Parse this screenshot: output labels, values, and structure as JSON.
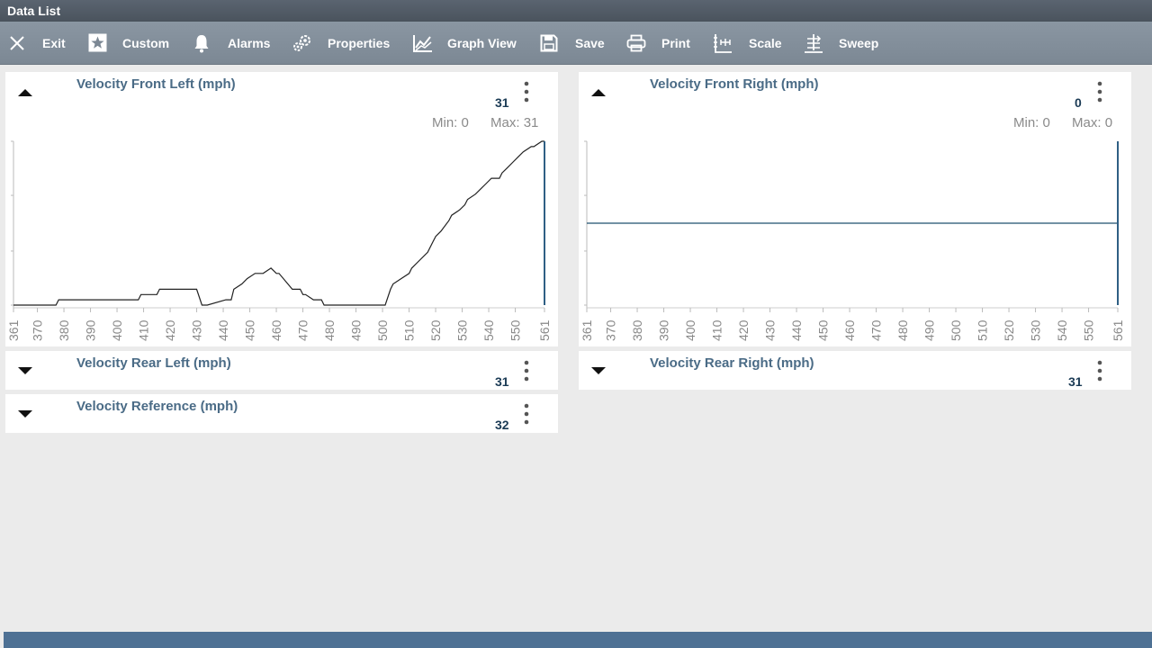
{
  "window": {
    "title": "Data List"
  },
  "toolbar": [
    {
      "id": "exit",
      "label": "Exit",
      "icon": "close-icon"
    },
    {
      "id": "custom",
      "label": "Custom",
      "icon": "star-icon"
    },
    {
      "id": "alarms",
      "label": "Alarms",
      "icon": "bell-icon"
    },
    {
      "id": "properties",
      "label": "Properties",
      "icon": "gears-icon"
    },
    {
      "id": "graph-view",
      "label": "Graph View",
      "icon": "graph-icon"
    },
    {
      "id": "save",
      "label": "Save",
      "icon": "floppy-icon"
    },
    {
      "id": "print",
      "label": "Print",
      "icon": "printer-icon"
    },
    {
      "id": "scale",
      "label": "Scale",
      "icon": "scale-icon"
    },
    {
      "id": "sweep",
      "label": "Sweep",
      "icon": "sweep-icon"
    }
  ],
  "panels": {
    "front_left": {
      "title": "Velocity Front Left (mph)",
      "value": "31",
      "min_label": "Min: 0",
      "max_label": "Max: 31"
    },
    "front_right": {
      "title": "Velocity Front Right (mph)",
      "value": "0",
      "min_label": "Min: 0",
      "max_label": "Max: 0"
    },
    "rear_left": {
      "title": "Velocity Rear Left (mph)",
      "value": "31"
    },
    "rear_right": {
      "title": "Velocity Rear Right (mph)",
      "value": "31"
    },
    "reference": {
      "title": "Velocity Reference (mph)",
      "value": "32"
    }
  },
  "chart_data": [
    {
      "type": "line",
      "series_of": "Velocity Front Left (mph)",
      "x_ticks": [
        "361",
        "370",
        "380",
        "390",
        "400",
        "410",
        "420",
        "430",
        "440",
        "450",
        "460",
        "470",
        "480",
        "490",
        "500",
        "510",
        "520",
        "530",
        "540",
        "550",
        "561"
      ],
      "xlim": [
        361,
        561
      ],
      "ylim": [
        0,
        31
      ],
      "x": [
        361,
        377,
        378,
        408,
        409,
        415,
        416,
        430,
        432,
        434,
        441,
        443,
        444,
        447,
        449,
        452,
        455,
        458,
        460,
        461,
        466,
        469,
        470,
        471,
        474,
        477,
        478,
        501,
        503,
        504,
        507,
        510,
        511,
        513,
        517,
        519,
        520,
        522,
        525,
        526,
        529,
        531,
        532,
        535,
        537,
        539,
        541,
        544,
        545,
        547,
        549,
        551,
        553,
        556,
        557,
        560,
        561
      ],
      "y": [
        0,
        0,
        1,
        1,
        2,
        2,
        3,
        3,
        0,
        0,
        1,
        1,
        3,
        4,
        5,
        6,
        6,
        7,
        6,
        6,
        3,
        3,
        2,
        2,
        1,
        1,
        0,
        0,
        3,
        4,
        5,
        6,
        7,
        8,
        10,
        12,
        13,
        14,
        16,
        17,
        18,
        19,
        20,
        21,
        22,
        23,
        24,
        24,
        25,
        26,
        27,
        28,
        29,
        30,
        30,
        31,
        31
      ]
    },
    {
      "type": "line",
      "series_of": "Velocity Front Right (mph)",
      "x_ticks": [
        "361",
        "370",
        "380",
        "390",
        "400",
        "410",
        "420",
        "430",
        "440",
        "450",
        "460",
        "470",
        "480",
        "490",
        "500",
        "510",
        "520",
        "530",
        "540",
        "550",
        "561"
      ],
      "xlim": [
        361,
        561
      ],
      "ylim": [
        -1,
        1
      ],
      "x": [
        361,
        561
      ],
      "y": [
        0,
        0
      ]
    }
  ]
}
